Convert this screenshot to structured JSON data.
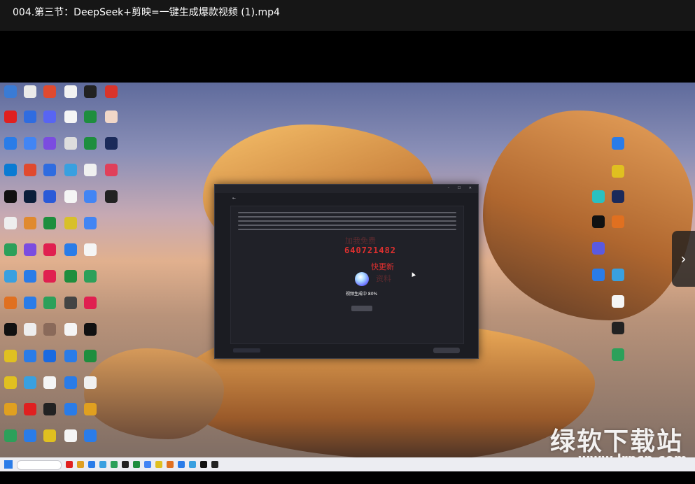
{
  "window": {
    "title": "004.第三节：DeepSeek+剪映=一键生成爆款视频 (1).mp4"
  },
  "dialog": {
    "progress_text": "视频生成中 80%"
  },
  "overlays": {
    "qq_number": "640721482",
    "faint_text_1": "加我免费",
    "kuaigengxin": "快更新",
    "faint_text_3": "资料"
  },
  "watermark": {
    "site_name": "绿软下载站",
    "site_url": "www.lrpcp.com"
  },
  "icons": {
    "next": "chevron-right-icon"
  },
  "colors": {
    "title_bg": "#161616",
    "dialog_bg": "#1b1c22",
    "overlay_red": "#e0302f"
  }
}
